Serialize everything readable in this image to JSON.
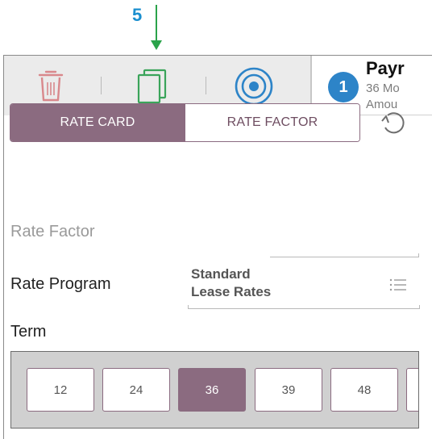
{
  "callout": {
    "number": "5"
  },
  "toolbar": {
    "icons": [
      "trash-icon",
      "duplicate-icon",
      "target-icon"
    ],
    "colors": {
      "trash": "#d9888c",
      "duplicate": "#3aa45a",
      "target": "#2d84c8"
    }
  },
  "payment": {
    "step": "1",
    "title": "Payr",
    "line1": "36 Mo",
    "line2": "Amou"
  },
  "segmented": {
    "active_label": "RATE CARD",
    "inactive_label": "RATE FACTOR"
  },
  "form": {
    "rate_factor_label": "Rate Factor",
    "rate_program_label": "Rate Program",
    "rate_program_value_1": "Standard",
    "rate_program_value_2": "Lease Rates",
    "term_label": "Term"
  },
  "terms": {
    "options": [
      "12",
      "24",
      "36",
      "39",
      "48"
    ],
    "selected": "36"
  },
  "colors": {
    "accent": "#8b6b80",
    "step_badge": "#2d84c8",
    "callout": "#1a8fcf",
    "callout_arrow": "#2aa34a"
  }
}
